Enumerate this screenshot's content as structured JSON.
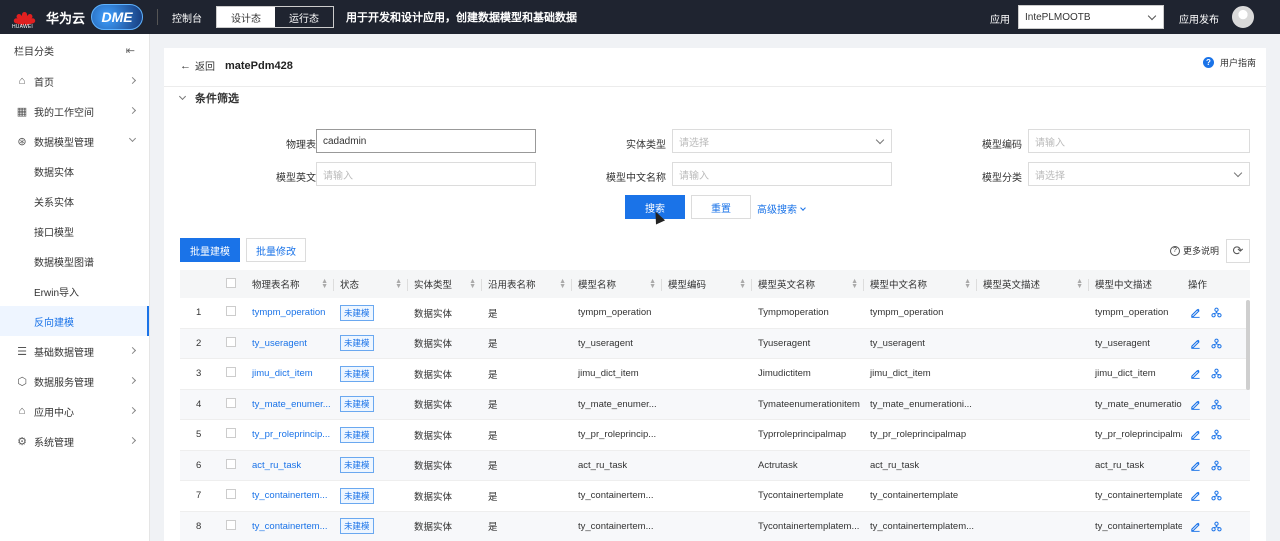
{
  "topbar": {
    "huawei": "HUAWEI",
    "brand": "华为云",
    "dme": "DME",
    "console": "控制台",
    "mode_design": "设计态",
    "mode_run": "运行态",
    "description": "用于开发和设计应用，创建数据模型和基础数据",
    "app_label": "应用",
    "app_value": "IntePLMOOTB",
    "publish": "应用发布"
  },
  "sidebar": {
    "header": "栏目分类",
    "items": [
      {
        "label": "首页"
      },
      {
        "label": "我的工作空间"
      },
      {
        "label": "数据模型管理"
      },
      {
        "label": "基础数据管理"
      },
      {
        "label": "数据服务管理"
      },
      {
        "label": "应用中心"
      },
      {
        "label": "系统管理"
      }
    ],
    "sub_items": [
      {
        "label": "数据实体"
      },
      {
        "label": "关系实体"
      },
      {
        "label": "接口模型"
      },
      {
        "label": "数据模型图谱"
      },
      {
        "label": "Erwin导入"
      },
      {
        "label": "反向建模"
      }
    ]
  },
  "page": {
    "back": "返回",
    "title": "matePdm428",
    "guide": "用户指南",
    "filter_title": "条件筛选"
  },
  "filters": {
    "phys_name_label": "物理表名称",
    "phys_name_value": "cadadmin",
    "entity_type_label": "实体类型",
    "entity_type_placeholder": "请选择",
    "model_code_label": "模型编码",
    "model_code_placeholder": "请输入",
    "en_name_label": "模型英文名称",
    "en_name_placeholder": "请输入",
    "cn_name_label": "模型中文名称",
    "cn_name_placeholder": "请输入",
    "category_label": "模型分类",
    "category_placeholder": "请选择",
    "search": "搜索",
    "reset": "重置",
    "advanced": "高级搜索"
  },
  "toolbar": {
    "batch_model": "批量建模",
    "batch_edit": "批量修改",
    "more_help": "更多说明"
  },
  "table": {
    "columns": [
      "物理表名称",
      "状态",
      "实体类型",
      "沿用表名称",
      "模型名称",
      "模型编码",
      "模型英文名称",
      "模型中文名称",
      "模型英文描述",
      "模型中文描述",
      "操作"
    ],
    "rows": [
      {
        "no": "1",
        "phys": "tympm_operation",
        "status": "未建模",
        "type": "数据实体",
        "reuse": "是",
        "model": "tympm_operation",
        "code": "",
        "en": "Tympmoperation",
        "cn": "tympm_operation",
        "en_desc": "",
        "cn_desc": "tympm_operation"
      },
      {
        "no": "2",
        "phys": "ty_useragent",
        "status": "未建模",
        "type": "数据实体",
        "reuse": "是",
        "model": "ty_useragent",
        "code": "",
        "en": "Tyuseragent",
        "cn": "ty_useragent",
        "en_desc": "",
        "cn_desc": "ty_useragent"
      },
      {
        "no": "3",
        "phys": "jimu_dict_item",
        "status": "未建模",
        "type": "数据实体",
        "reuse": "是",
        "model": "jimu_dict_item",
        "code": "",
        "en": "Jimudictitem",
        "cn": "jimu_dict_item",
        "en_desc": "",
        "cn_desc": "jimu_dict_item"
      },
      {
        "no": "4",
        "phys": "ty_mate_enumer...",
        "status": "未建模",
        "type": "数据实体",
        "reuse": "是",
        "model": "ty_mate_enumer...",
        "code": "",
        "en": "Tymateenumerationitem",
        "cn": "ty_mate_enumerationi...",
        "en_desc": "",
        "cn_desc": "ty_mate_enumeration"
      },
      {
        "no": "5",
        "phys": "ty_pr_roleprincip...",
        "status": "未建模",
        "type": "数据实体",
        "reuse": "是",
        "model": "ty_pr_roleprincip...",
        "code": "",
        "en": "Typrroleprincipalmap",
        "cn": "ty_pr_roleprincipalmap",
        "en_desc": "",
        "cn_desc": "ty_pr_roleprincipalma"
      },
      {
        "no": "6",
        "phys": "act_ru_task",
        "status": "未建模",
        "type": "数据实体",
        "reuse": "是",
        "model": "act_ru_task",
        "code": "",
        "en": "Actrutask",
        "cn": "act_ru_task",
        "en_desc": "",
        "cn_desc": "act_ru_task"
      },
      {
        "no": "7",
        "phys": "ty_containertem...",
        "status": "未建模",
        "type": "数据实体",
        "reuse": "是",
        "model": "ty_containertem...",
        "code": "",
        "en": "Tycontainertemplate",
        "cn": "ty_containertemplate",
        "en_desc": "",
        "cn_desc": "ty_containertemplate"
      },
      {
        "no": "8",
        "phys": "ty_containertem...",
        "status": "未建模",
        "type": "数据实体",
        "reuse": "是",
        "model": "ty_containertem...",
        "code": "",
        "en": "Tycontainertemplatem...",
        "cn": "ty_containertemplatem...",
        "en_desc": "",
        "cn_desc": "ty_containertemplate"
      }
    ]
  },
  "colors": {
    "accent": "#1a73e8",
    "topbar_bg": "#1f2430",
    "badge_border": "#6aa8f0"
  }
}
